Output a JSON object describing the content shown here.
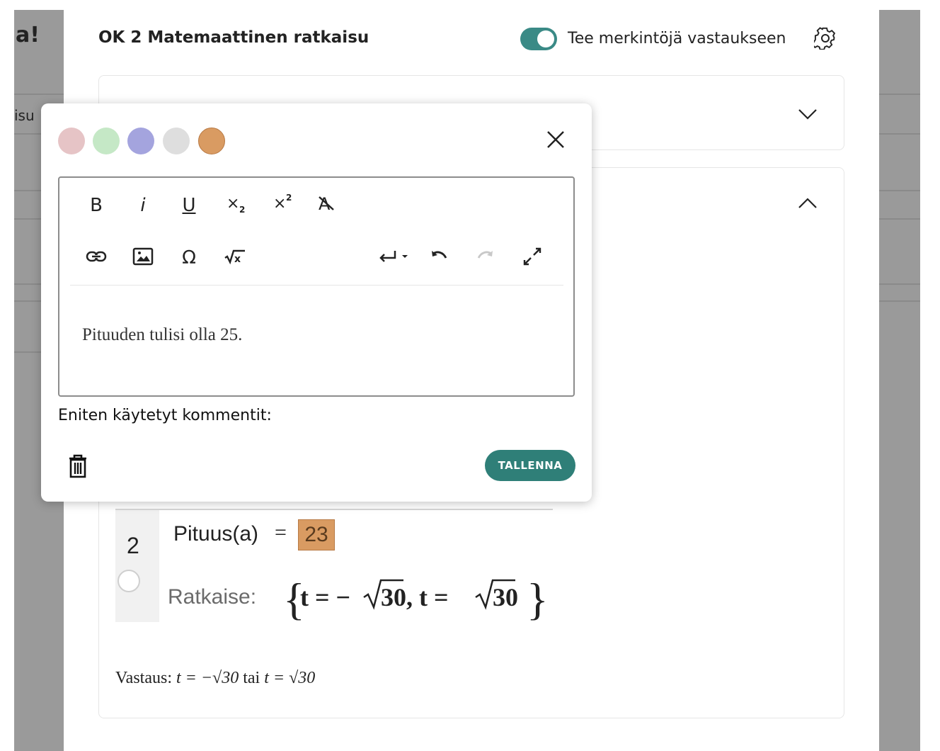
{
  "background": {
    "left_heading_fragment": "a!",
    "left_item_fragment": "isu"
  },
  "header": {
    "title": "OK 2 Matemaattinen ratkaisu",
    "annotate_toggle": {
      "label": "Tee merkintöjä vastaukseen",
      "on": true
    },
    "settings_icon": "gear-icon"
  },
  "geogebra": {
    "row_number": "2",
    "expression_name": "Pituus(a)",
    "equals": "=",
    "highlighted_value": "23",
    "solve_label": "Ratkaise:",
    "solution_text": "{t = −√30, t = √30}"
  },
  "answer": {
    "label": "Vastaus:",
    "part1": "t = −√30",
    "connector": "tai",
    "part2": "t = √30"
  },
  "comment_popup": {
    "colors": [
      "#e6c4c6",
      "#c5e8c6",
      "#a4a4de",
      "#dedede",
      "#d99b62"
    ],
    "selected_color": "#d99b62",
    "toolbar": {
      "bold": "B",
      "italic": "i",
      "underline": "U",
      "subscript_icon": "subscript-icon",
      "superscript_icon": "superscript-icon",
      "clear_format_icon": "clear-formatting-icon",
      "link_icon": "link-icon",
      "image_icon": "image-icon",
      "special_char": "Ω",
      "math_icon": "math-formula-icon",
      "newline_icon": "line-break-icon",
      "undo_icon": "undo-icon",
      "redo_icon": "redo-icon",
      "fullscreen_icon": "fullscreen-icon"
    },
    "editor_text": "Pituuden tulisi olla 25.",
    "common_comments_label": "Eniten käytetyt kommentit:",
    "save_label": "TALLENNA",
    "delete_icon": "trash-icon",
    "close_icon": "close-icon"
  }
}
